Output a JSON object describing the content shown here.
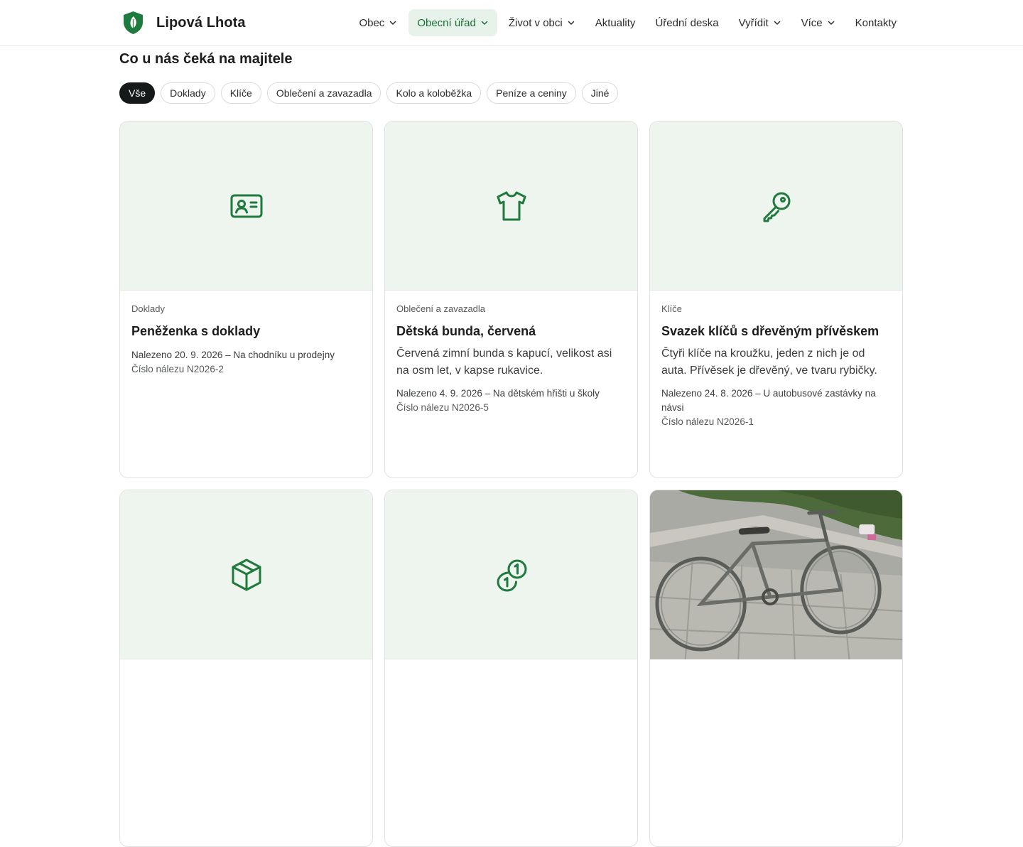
{
  "brand": {
    "name": "Lipová Lhota"
  },
  "nav": [
    {
      "label": "Obec",
      "dropdown": true,
      "active": false
    },
    {
      "label": "Obecní úřad",
      "dropdown": true,
      "active": true
    },
    {
      "label": "Život v obci",
      "dropdown": true,
      "active": false
    },
    {
      "label": "Aktuality",
      "dropdown": false,
      "active": false
    },
    {
      "label": "Úřední deska",
      "dropdown": false,
      "active": false
    },
    {
      "label": "Vyřídit",
      "dropdown": true,
      "active": false
    },
    {
      "label": "Více",
      "dropdown": true,
      "active": false
    },
    {
      "label": "Kontakty",
      "dropdown": false,
      "active": false
    }
  ],
  "section": {
    "title": "Co u nás čeká na majitele"
  },
  "filters": [
    "Vše",
    "Doklady",
    "Klíče",
    "Oblečení a zavazadla",
    "Kolo a koloběžka",
    "Peníze a ceniny",
    "Jiné"
  ],
  "active_filter": "Vše",
  "cards": [
    {
      "icon": "id-card-icon",
      "category": "Doklady",
      "title": "Peněženka s doklady",
      "description": "",
      "found": "Nalezeno 20. 9. 2026 – Na chodníku u prodejny",
      "number": "Číslo nálezu N2026-2"
    },
    {
      "icon": "tshirt-icon",
      "category": "Oblečení a zavazadla",
      "title": "Dětská bunda, červená",
      "description": "Červená zimní bunda s kapucí, velikost asi na osm let, v kapse rukavice.",
      "found": "Nalezeno 4. 9. 2026 – Na dětském hřišti u školy",
      "number": "Číslo nálezu N2026-5"
    },
    {
      "icon": "key-icon",
      "category": "Klíče",
      "title": "Svazek klíčů s dřevěným přívěskem",
      "description": "Čtyři klíče na kroužku, jeden z nich je od auta. Přívěsek je dřevěný, ve tvaru rybičky.",
      "found": "Nalezeno 24. 8. 2026 – U autobusové zastávky na návsi",
      "number": "Číslo nálezu N2026-1"
    },
    {
      "icon": "package-icon",
      "category": "",
      "title": "",
      "description": "",
      "found": "",
      "number": ""
    },
    {
      "icon": "coins-icon",
      "category": "",
      "title": "",
      "description": "",
      "found": "",
      "number": ""
    },
    {
      "icon": "bicycle-photo",
      "category": "",
      "title": "",
      "description": "",
      "found": "",
      "number": ""
    }
  ],
  "colors": {
    "accent": "#186f36",
    "accent_bg": "#e7f2ea",
    "media_bg": "#eef5ef",
    "chip_active": "#15191a"
  }
}
